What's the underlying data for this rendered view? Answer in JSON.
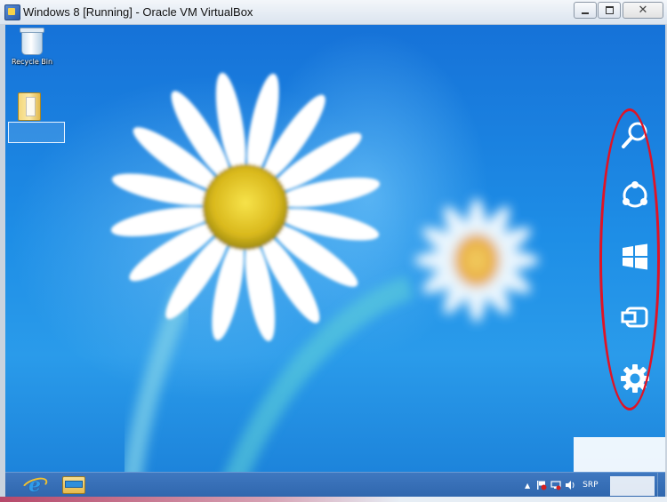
{
  "window": {
    "title": "Windows 8 [Running] - Oracle VM VirtualBox",
    "controls": {
      "minimize": "",
      "maximize": "",
      "close": "✕"
    }
  },
  "desktop": {
    "icons": [
      {
        "label": "Recycle Bin",
        "icon": "recycle-bin-icon"
      },
      {
        "label": "",
        "icon": "folder-icon"
      }
    ]
  },
  "charms": [
    {
      "name": "Search",
      "icon": "search-icon"
    },
    {
      "name": "Share",
      "icon": "share-icon"
    },
    {
      "name": "Start",
      "icon": "windows-start-icon"
    },
    {
      "name": "Devices",
      "icon": "devices-icon"
    },
    {
      "name": "Settings",
      "icon": "gear-icon"
    }
  ],
  "taskbar": {
    "pinned": [
      {
        "name": "Internet Explorer",
        "icon": "internet-explorer-icon"
      },
      {
        "name": "File Explorer",
        "icon": "file-explorer-icon"
      }
    ],
    "tray": {
      "chevron": "▲",
      "language": "SRP"
    }
  },
  "colors": {
    "wallpaper_blue": "#1e8ee6",
    "taskbar": "#2f66ad",
    "highlight_ring": "#e01325"
  }
}
